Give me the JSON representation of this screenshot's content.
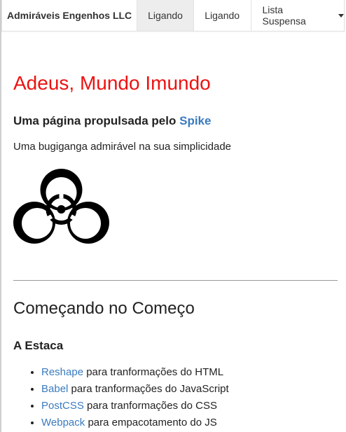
{
  "navbar": {
    "brand": "Admiráveis Engenhos LLC",
    "items": [
      {
        "label": "Ligando",
        "active": true
      },
      {
        "label": "Ligando",
        "active": false
      }
    ],
    "dropdown": {
      "label": "Lista Suspensa",
      "icon": "caret-down-icon"
    }
  },
  "main": {
    "title": "Adeus, Mundo Imundo",
    "title_color": "#ee1111",
    "subtitle_prefix": "Uma página propulsada pelo",
    "subtitle_link": "Spike",
    "tagline": "Uma bugiganga admirável na sua simplicidade",
    "image_icon": "biohazard-icon",
    "section_title": "Começando no Começo",
    "sub_section_title": "A Estaca",
    "tools": [
      {
        "name": "Reshape",
        "description": "para tranformações do HTML"
      },
      {
        "name": "Babel",
        "description": "para tranformações do JavaScript"
      },
      {
        "name": "PostCSS",
        "description": "para tranformações do CSS"
      },
      {
        "name": "Webpack",
        "description": "para empacotamento do JS"
      }
    ]
  },
  "colors": {
    "link": "#3a7bbf",
    "active_nav_bg": "#ededed"
  }
}
